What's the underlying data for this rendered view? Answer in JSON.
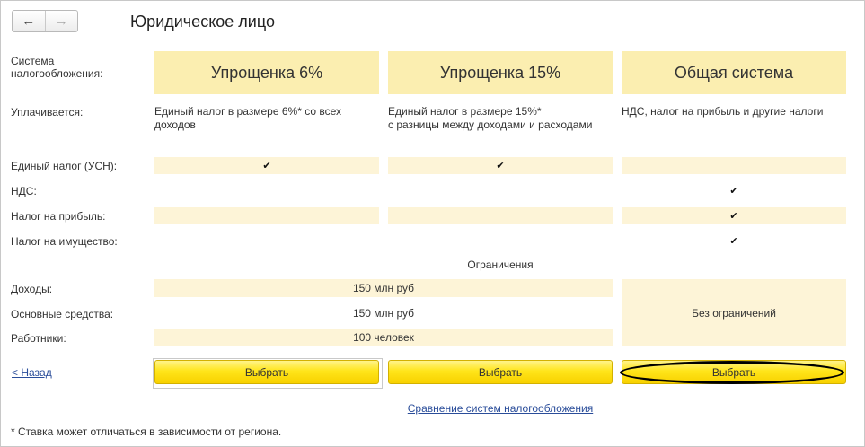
{
  "window": {
    "title": "Юридическое лицо"
  },
  "nav": {
    "back_icon": "←",
    "forward_icon": "→"
  },
  "labels": {
    "system": "Система\nналогообложения:",
    "paid": "Уплачивается:",
    "usn_tax": "Единый налог (УСН):",
    "vat": "НДС:",
    "profit_tax": "Налог на прибыль:",
    "property_tax": "Налог на имущество:",
    "income": "Доходы:",
    "fixed_assets": "Основные средства:",
    "employees": "Работники:"
  },
  "columns": [
    {
      "name": "Упрощенка 6%",
      "description": "Единый налог в размере 6%* со всех\nдоходов"
    },
    {
      "name": "Упрощенка 15%",
      "description": "Единый налог в размере 15%*\nс разницы между доходами и расходами"
    },
    {
      "name": "Общая система",
      "description": "НДС, налог на прибыль и другие налоги"
    }
  ],
  "check_mark": "✔",
  "limits": {
    "heading": "Ограничения",
    "income_value": "150 млн руб",
    "fixed_assets_value": "150 млн руб",
    "employees_value": "100 человек",
    "general_value": "Без ограничений"
  },
  "buttons": {
    "select_label": "Выбрать",
    "back_link": "< Назад"
  },
  "links": {
    "compare": "Сравнение систем налогообложения"
  },
  "footnote": "* Ставка может отличаться в зависимости от региона.",
  "colors": {
    "header_band": "#fbeeb0",
    "light_band": "#fdf4d7",
    "button_yellow": "#ffe51a",
    "link": "#2a4d9a"
  }
}
